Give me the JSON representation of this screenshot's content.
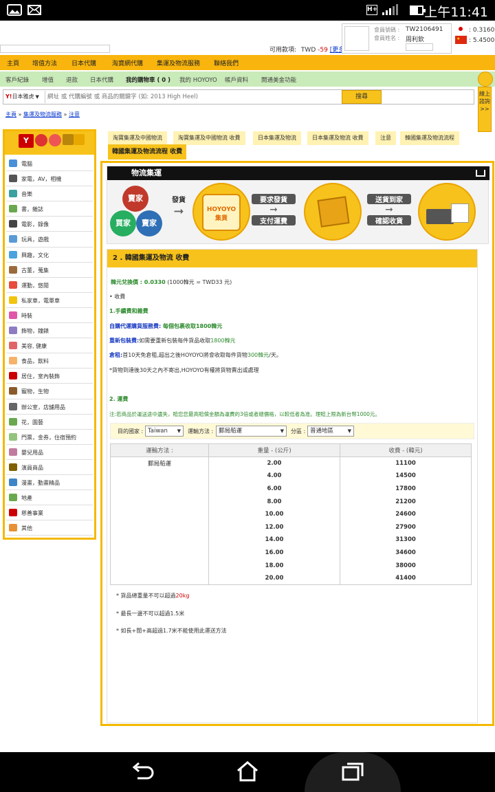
{
  "status_bar": {
    "time": "上午11:41"
  },
  "header": {
    "member_no_label": "會員號碼 :",
    "member_no": "TW2106491",
    "member_name_label": "會員姓名 :",
    "member_name": "周利欽 ptkchou",
    "available_label": "可用款項:",
    "currency": "TWD",
    "balance": "-59",
    "more": "[更多]",
    "rate_jp": ": 0.3160",
    "rate_cn": ": 5.4500"
  },
  "top_nav": [
    "主頁",
    "增值方法",
    "日本代購",
    "淘寶網代購",
    "集運及物流服務",
    "聯絡我們"
  ],
  "sub_nav": [
    "客戶紀錄",
    "增值",
    "退款",
    "日本代購",
    "我的購物車 ( 0 )",
    "我的 HOYOYO",
    "帳戶資料",
    "開通美金功能"
  ],
  "search": {
    "source": "日本雅虎",
    "placeholder": "網址 或 代購編號 或 商品的關鍵字 (如: 2013 High Heel)",
    "button": "搜尋"
  },
  "side_badge": "線上諮詢 >>",
  "breadcrumb": {
    "home": "主頁",
    "sep": " » ",
    "section": "集運及物流服務",
    "current": "注意"
  },
  "categories": [
    "電腦",
    "家電，AV，相機",
    "音樂",
    "書，雜誌",
    "電影，錄像",
    "玩具，遊戲",
    "興趣，文化",
    "古董，蒐集",
    "運動，悠閒",
    "私家車，電單車",
    "時裝",
    "飾物，鐘錶",
    "美容, 健康",
    "食品，飲料",
    "居住，室內裝飾",
    "寵物，生物",
    "辦公室，店舖用品",
    "花，園藝",
    "門票，金券，住宿預約",
    "嬰兒用品",
    "演員商品",
    "漫畫，動畫精品",
    "地產",
    "慈善事業",
    "其他"
  ],
  "cat_colors": [
    "#4a90d9",
    "#555555",
    "#3aa0a0",
    "#6aa84f",
    "#444444",
    "#5b9bd5",
    "#4aa3df",
    "#9c6b3c",
    "#e84c3d",
    "#f1c40f",
    "#e056a8",
    "#8e7cc3",
    "#e06666",
    "#f6b26b",
    "#cc0000",
    "#8b5a2b",
    "#666666",
    "#6aa84f",
    "#93c47d",
    "#c27ba0",
    "#7f6000",
    "#3d85c6",
    "#6aa84f",
    "#cc0000",
    "#e69138"
  ],
  "tabs": [
    "淘寶集運及中國物流",
    "淘寶集運及中國物流 收費",
    "日本集運及物流",
    "日本集運及物流 收費",
    "注意",
    "韓國集運及物流流程"
  ],
  "active_tab": "韓國集運及物流流程 收費",
  "banner": {
    "title": "物流集運",
    "seller": "賣家",
    "buyer": "買家",
    "ship": "發貨",
    "hub": "HOYOYO 集貨",
    "request": "要求發貨",
    "pay": "支付運費",
    "deliver": "送貨到家",
    "confirm": "確認收貨"
  },
  "section_title": "2 . 韓國集運及物流 收費",
  "fx": {
    "label": "韓元兌換價 : 0.0330",
    "note": "(1000韓元 = TWD33 元)"
  },
  "fees": {
    "heading": "• 收費",
    "h1": "1.手續費和雜費",
    "svc_label": "自購代運購貨服務費:",
    "svc_text": " 每個包裹收取1800韓元",
    "repack_label": "重新包裝費:",
    "repack_text": "如需要重新包裝每件貨品收取",
    "repack_amount": "1800韓元",
    "storage_label": "倉租:",
    "storage_text": "首10天免倉租,超出之後HOYOYO將會收取每件貨物",
    "storage_amount": "300韓元",
    "storage_unit": "/天。",
    "note": "*貨物到達後30天之內不寄出,HOYOYO有權將貨物賣出或處理"
  },
  "shipping": {
    "heading": "2. 運費",
    "note": "注:若商品於運送途中遺失，賠您您最高賠償金額為運費的3倍或者總價格，以較低者為准。理賠上限為新台幣1000元。"
  },
  "filter": {
    "country_label": "目的國家 :",
    "country": "Taiwan",
    "method_label": "運輸方法 :",
    "method": "郵局船運",
    "zone_label": "分區 :",
    "zone": "普通地區"
  },
  "table": {
    "headers": [
      "運輸方法 :",
      "重量 - (公斤)",
      "收費 - (韓元)"
    ],
    "method": "郵局船運",
    "rows": [
      [
        "2.00",
        "11100"
      ],
      [
        "4.00",
        "14500"
      ],
      [
        "6.00",
        "17800"
      ],
      [
        "8.00",
        "21200"
      ],
      [
        "10.00",
        "24600"
      ],
      [
        "12.00",
        "27900"
      ],
      [
        "14.00",
        "31300"
      ],
      [
        "16.00",
        "34600"
      ],
      [
        "18.00",
        "38000"
      ],
      [
        "20.00",
        "41400"
      ]
    ]
  },
  "notes": {
    "n1_prefix": "* 貨品總重量不可以超過",
    "n1_value": "20kg",
    "n2": "* 最長一邊不可以超過1.5米",
    "n3": "* 如長+闊+高超過1.7米不能使用此運送方法"
  }
}
